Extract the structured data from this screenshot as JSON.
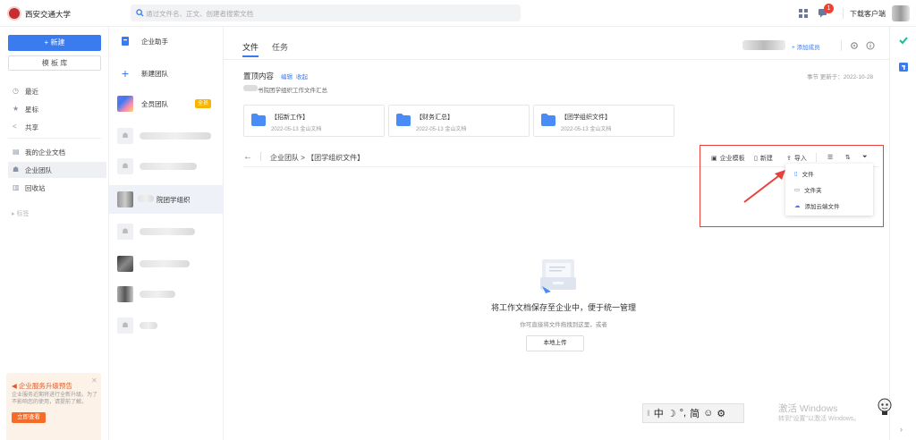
{
  "topbar": {
    "university": "西安交通大学",
    "search_placeholder": "通过文件名、正文、创建者搜索文档",
    "badge_count": "1",
    "download_client": "下载客户端"
  },
  "leftnav": {
    "new_label": "+ 新建",
    "template_label": "模 板 库",
    "items": [
      {
        "label": "最近",
        "icon": "clock-icon"
      },
      {
        "label": "星标",
        "icon": "star-icon"
      },
      {
        "label": "共享",
        "icon": "share-icon"
      },
      {
        "label": "我的企业文档",
        "icon": "doc-icon"
      },
      {
        "label": "企业团队",
        "icon": "team-icon"
      },
      {
        "label": "回收站",
        "icon": "trash-icon"
      }
    ],
    "tags_label": "▸ 标签",
    "promo": {
      "title": "企业服务升级预告",
      "desc": "企业服务近期将进行全新升级。为了不影响您的使用，请提前了解。",
      "button": "立即查看"
    }
  },
  "teams": {
    "assistant": "企业助手",
    "new_team": "新建团队",
    "all_team": "全员团队",
    "all_tag": "全员",
    "active_team_suffix": "院团学组织"
  },
  "main": {
    "tabs": [
      "文件",
      "任务"
    ],
    "add_member": "添加成员",
    "pinned": {
      "title": "置顶内容",
      "edit": "编辑",
      "fold": "收起",
      "meta": "事节  更新于：2022-10-28",
      "desc": "书院团学组织工作文件汇总"
    },
    "cards": [
      {
        "name": "【招新工作】",
        "date": "2022-05-13  金山文档"
      },
      {
        "name": "【财务汇总】",
        "date": "2022-05-13  金山文档"
      },
      {
        "name": "【团学组织文件】",
        "date": "2022-05-13  金山文档"
      }
    ],
    "breadcrumb": "企业团队  >  【团学组织文件】",
    "toolbar": {
      "template": "企业模板",
      "new": "新建",
      "import": "导入"
    },
    "dropdown": [
      "文件",
      "文件夹",
      "添加云端文件"
    ],
    "empty": {
      "title": "将工作文档保存至企业中，便于统一管理",
      "sub": "你可直接将文件拖拽到这里，或者",
      "upload": "本地上传"
    }
  },
  "ime": [
    "中",
    "☽",
    "°,",
    "简",
    "☺",
    "⚙"
  ],
  "watermark": {
    "line1": "激活 Windows",
    "line2": "转到\"设置\"以激活 Windows。"
  }
}
